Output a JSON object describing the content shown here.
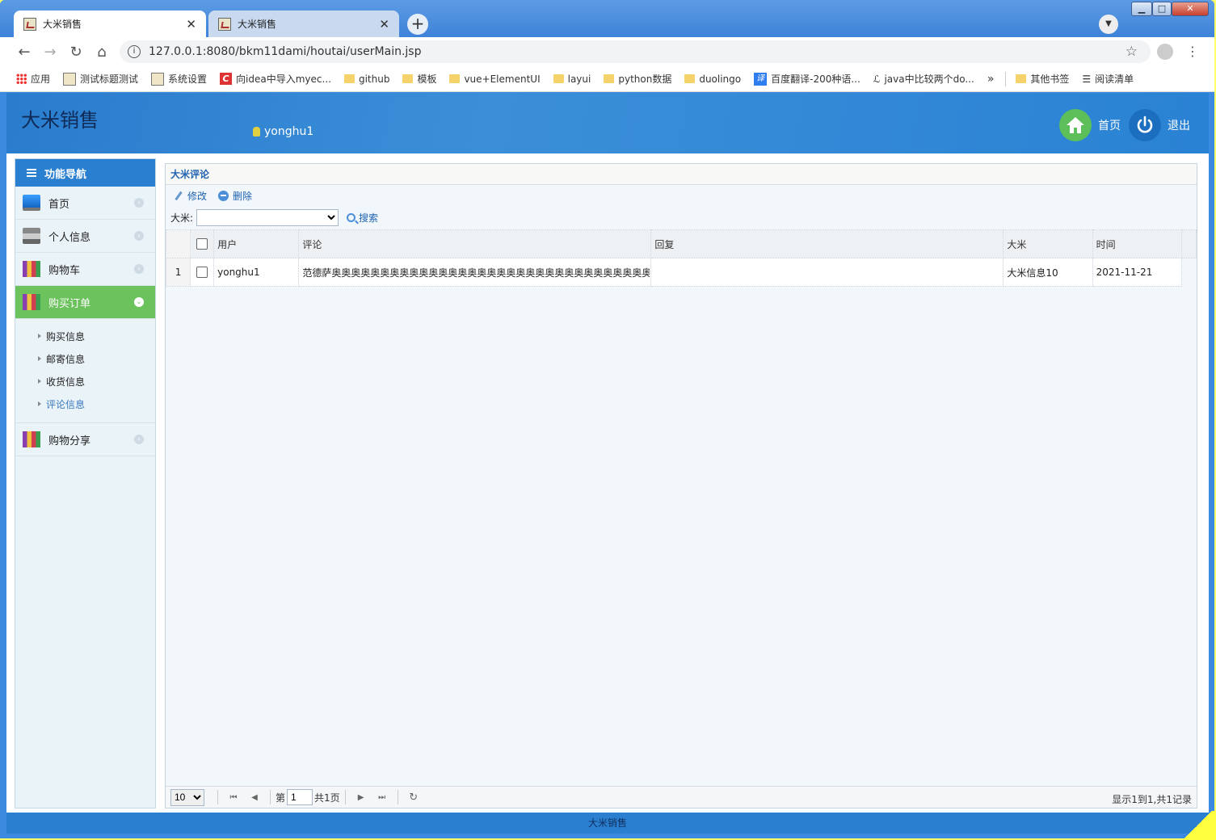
{
  "browser": {
    "tabs": [
      {
        "title": "大米销售",
        "close": "✕"
      },
      {
        "title": "大米销售",
        "close": "✕"
      }
    ],
    "new_tab": "+",
    "url": "127.0.0.1:8080/bkm11dami/houtai/userMain.jsp",
    "bookmarks": [
      {
        "label": "应用",
        "icon": "apps-icon"
      },
      {
        "label": "测试标题测试",
        "icon": "page-icon"
      },
      {
        "label": "系统设置",
        "icon": "page-icon"
      },
      {
        "label": "向idea中导入myec...",
        "icon": "csdn-icon"
      },
      {
        "label": "github",
        "icon": "folder-icon"
      },
      {
        "label": "模板",
        "icon": "folder-icon"
      },
      {
        "label": "vue+ElementUI",
        "icon": "folder-icon"
      },
      {
        "label": "layui",
        "icon": "folder-icon"
      },
      {
        "label": "python数据",
        "icon": "folder-icon"
      },
      {
        "label": "duolingo",
        "icon": "folder-icon"
      },
      {
        "label": "百度翻译-200种语...",
        "icon": "translate-icon"
      },
      {
        "label": "java中比较两个do...",
        "icon": "link-icon"
      }
    ],
    "bookmarks_more": "»",
    "other_bookmarks": "其他书签",
    "reading_list": "阅读清单"
  },
  "app": {
    "title": "大米销售",
    "username": "yonghu1",
    "home_label": "首页",
    "logout_label": "退出",
    "footer": "大米销售"
  },
  "sidebar": {
    "header": "功能导航",
    "items": [
      {
        "label": "首页",
        "icon": "monitor-icon"
      },
      {
        "label": "个人信息",
        "icon": "printer-icon"
      },
      {
        "label": "购物车",
        "icon": "books-icon"
      },
      {
        "label": "购买订单",
        "icon": "books-icon",
        "active": true
      },
      {
        "label": "购物分享",
        "icon": "books-icon"
      }
    ],
    "subitems": [
      "购买信息",
      "邮寄信息",
      "收货信息",
      "评论信息"
    ]
  },
  "panel": {
    "title": "大米评论",
    "edit_label": "修改",
    "delete_label": "删除",
    "filter_label": "大米:",
    "filter_value": "",
    "search_label": "搜索",
    "columns": [
      "用户",
      "评论",
      "回复",
      "大米",
      "时间"
    ],
    "rows": [
      {
        "num": "1",
        "user": "yonghu1",
        "comment": "范德萨奥奥奥奥奥奥奥奥奥奥奥奥奥奥奥奥奥奥奥奥奥奥奥奥奥奥奥奥奥奥奥奥奥奥奥奥",
        "reply": "",
        "rice": "大米信息10",
        "time": "2021-11-21"
      }
    ]
  },
  "pager": {
    "page_size": "10",
    "page_prefix": "第",
    "page_value": "1",
    "page_suffix": "共1页",
    "info": "显示1到1,共1记录"
  }
}
